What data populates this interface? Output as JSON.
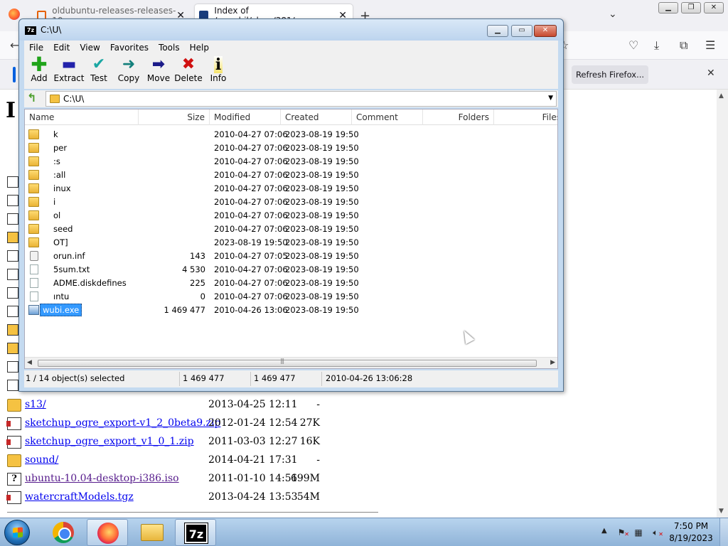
{
  "firefox": {
    "tabs": [
      {
        "title": "oldubuntu-releases-releases-10",
        "favicon_color": "#e66000"
      },
      {
        "title": "Index of /~sushil/class/381/wa",
        "favicon_color": "#1a3d7c"
      }
    ],
    "notification": {
      "refresh_label": "Refresh Firefox..."
    },
    "page_heading": "I",
    "listing": [
      {
        "name": "s13/",
        "date": "2013-04-25 12:11",
        "size": "-",
        "icon": "folder",
        "visited": false
      },
      {
        "name": "sketchup_ogre_export-v1_2_0beta9.zip",
        "date": "2012-01-24 12:54",
        "size": "27K",
        "icon": "zip",
        "visited": false
      },
      {
        "name": "sketchup_ogre_export_v1_0_1.zip",
        "date": "2011-03-03 12:27",
        "size": "16K",
        "icon": "zip",
        "visited": false
      },
      {
        "name": "sound/",
        "date": "2014-04-21 17:31",
        "size": "-",
        "icon": "folder",
        "visited": false
      },
      {
        "name": "ubuntu-10.04-desktop-i386.iso",
        "date": "2011-01-10 14:51",
        "size": "699M",
        "icon": "unknown",
        "visited": true
      },
      {
        "name": "watercraftModels.tgz",
        "date": "2013-04-24 13:53",
        "size": "54M",
        "icon": "tgz",
        "visited": false
      }
    ]
  },
  "sevenzip": {
    "title": "C:\\U\\",
    "menu": [
      "File",
      "Edit",
      "View",
      "Favorites",
      "Tools",
      "Help"
    ],
    "toolbar": [
      {
        "label": "Add",
        "icon": "plus-icon",
        "glyph": "✚"
      },
      {
        "label": "Extract",
        "icon": "extract-icon",
        "glyph": "▬"
      },
      {
        "label": "Test",
        "icon": "test-icon",
        "glyph": "✔"
      },
      {
        "label": "Copy",
        "icon": "copy-icon",
        "glyph": "➜"
      },
      {
        "label": "Move",
        "icon": "move-icon",
        "glyph": "➡"
      },
      {
        "label": "Delete",
        "icon": "delete-icon",
        "glyph": "✖"
      },
      {
        "label": "Info",
        "icon": "info-icon",
        "glyph": "i"
      }
    ],
    "path": "C:\\U\\",
    "columns": [
      "Name",
      "Size",
      "Modified",
      "Created",
      "Comment",
      "Folders",
      "Files"
    ],
    "rows": [
      {
        "name": "k",
        "size": "",
        "modified": "2010-04-27 07:06",
        "created": "2023-08-19 19:50",
        "type": "folder"
      },
      {
        "name": "per",
        "size": "",
        "modified": "2010-04-27 07:06",
        "created": "2023-08-19 19:50",
        "type": "folder"
      },
      {
        "name": ":s",
        "size": "",
        "modified": "2010-04-27 07:06",
        "created": "2023-08-19 19:50",
        "type": "folder"
      },
      {
        "name": ":all",
        "size": "",
        "modified": "2010-04-27 07:06",
        "created": "2023-08-19 19:50",
        "type": "folder"
      },
      {
        "name": "inux",
        "size": "",
        "modified": "2010-04-27 07:06",
        "created": "2023-08-19 19:50",
        "type": "folder"
      },
      {
        "name": "i",
        "size": "",
        "modified": "2010-04-27 07:06",
        "created": "2023-08-19 19:50",
        "type": "folder"
      },
      {
        "name": "ol",
        "size": "",
        "modified": "2010-04-27 07:06",
        "created": "2023-08-19 19:50",
        "type": "folder"
      },
      {
        "name": "seed",
        "size": "",
        "modified": "2010-04-27 07:06",
        "created": "2023-08-19 19:50",
        "type": "folder"
      },
      {
        "name": "OT]",
        "size": "",
        "modified": "2023-08-19 19:50",
        "created": "2023-08-19 19:50",
        "type": "folder"
      },
      {
        "name": "orun.inf",
        "size": "143",
        "modified": "2010-04-27 07:05",
        "created": "2023-08-19 19:50",
        "type": "setting"
      },
      {
        "name": "5sum.txt",
        "size": "4 530",
        "modified": "2010-04-27 07:06",
        "created": "2023-08-19 19:50",
        "type": "file"
      },
      {
        "name": "ADME.diskdefines",
        "size": "225",
        "modified": "2010-04-27 07:06",
        "created": "2023-08-19 19:50",
        "type": "file"
      },
      {
        "name": "ıntu",
        "size": "0",
        "modified": "2010-04-27 07:06",
        "created": "2023-08-19 19:50",
        "type": "file"
      },
      {
        "name": "wubi.exe",
        "size": "1 469 477",
        "modified": "2010-04-26 13:06",
        "created": "2023-08-19 19:50",
        "type": "exe",
        "selected": true
      }
    ],
    "status": {
      "selection": "1 / 14 object(s) selected",
      "size": "1 469 477",
      "packed": "1 469 477",
      "date": "2010-04-26 13:06:28"
    }
  },
  "taskbar": {
    "time": "7:50 PM",
    "date": "8/19/2023"
  }
}
